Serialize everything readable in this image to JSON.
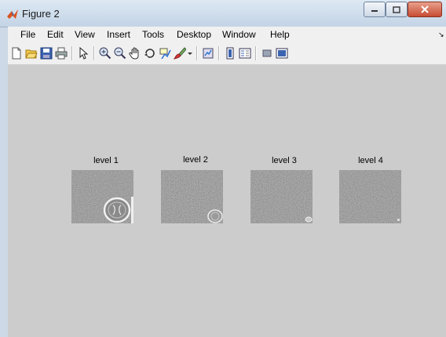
{
  "window": {
    "title": "Figure 2"
  },
  "menu": [
    "File",
    "Edit",
    "View",
    "Insert",
    "Tools",
    "Desktop",
    "Window",
    "Help"
  ],
  "toolbar": [
    "new-figure",
    "open-file",
    "save",
    "print",
    "edit-plot",
    "zoom-in",
    "zoom-out",
    "pan",
    "rotate-3d",
    "data-cursor",
    "brush",
    "link-plot",
    "insert-colorbar",
    "insert-legend",
    "hide-plot-tools",
    "show-plot-tools"
  ],
  "panels": [
    {
      "title": "level 1"
    },
    {
      "title": "level 2"
    },
    {
      "title": "level 3"
    },
    {
      "title": "level 4"
    }
  ],
  "colors": {
    "figure_bg": "#cccccc",
    "menubar_bg": "#f0f0f0",
    "titlebar": "#c3d4e6"
  }
}
